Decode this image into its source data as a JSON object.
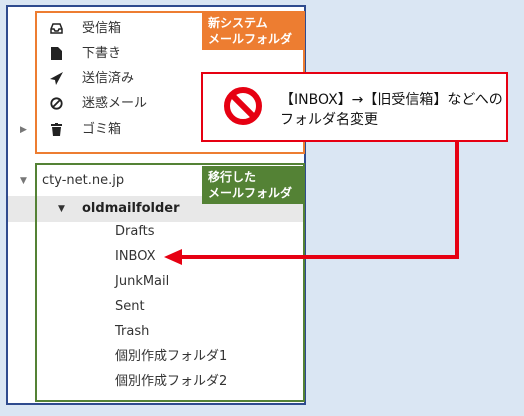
{
  "system_folders": [
    {
      "icon": "inbox-tray-icon",
      "label": "受信箱"
    },
    {
      "icon": "file-icon",
      "label": "下書き"
    },
    {
      "icon": "send-icon",
      "label": "送信済み"
    },
    {
      "icon": "block-icon",
      "label": "迷惑メール"
    },
    {
      "icon": "trash-icon",
      "label": "ゴミ箱"
    }
  ],
  "account": {
    "label": "cty-net.ne.jp"
  },
  "parent_folder": {
    "label": "oldmailfolder"
  },
  "migrated_folders": [
    "Drafts",
    "INBOX",
    "JunkMail",
    "Sent",
    "Trash",
    "個別作成フォルダ1",
    "個別作成フォルダ2"
  ],
  "tags": {
    "orange": {
      "line1": "新システム",
      "line2": "メールフォルダ"
    },
    "green": {
      "line1": "移行した",
      "line2": "メールフォルダ"
    }
  },
  "callout": {
    "line1": "【INBOX】→【旧受信箱】などへの",
    "line2": "フォルダ名変更"
  },
  "colors": {
    "orange": "#ed7d31",
    "green": "#548235",
    "red": "#e60012",
    "background": "#dae6f3"
  }
}
